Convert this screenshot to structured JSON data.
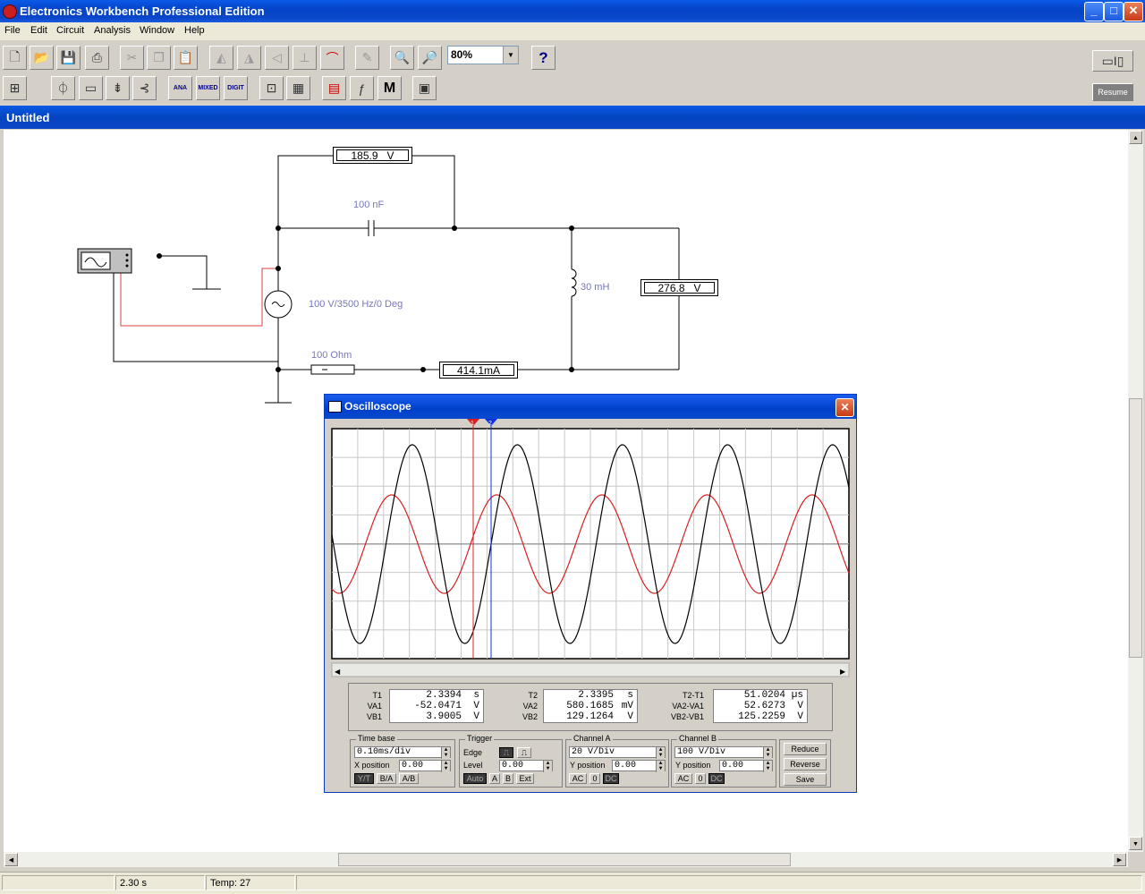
{
  "app": {
    "title": "Electronics Workbench Professional Edition",
    "window_buttons": {
      "minimize": "_",
      "maximize": "□",
      "close": "✕"
    }
  },
  "menu": [
    "File",
    "Edit",
    "Circuit",
    "Analysis",
    "Window",
    "Help"
  ],
  "toolbar": {
    "zoom": "80%",
    "help_label": "?",
    "parts_labels": {
      "analog_ics": "ANA",
      "mixed_ics": "MIXED",
      "digital_ics": "DIGIT",
      "misc_digital": "M"
    },
    "resume_label": "Resume"
  },
  "document": {
    "title": "Untitled"
  },
  "circuit": {
    "voltmeter_top": {
      "value": "185.9",
      "unit": "V"
    },
    "voltmeter_right": {
      "value": "276.8",
      "unit": "V"
    },
    "ammeter": {
      "value": "414.1m",
      "unit": "A"
    },
    "capacitor_label": "100 nF",
    "inductor_label": "30 mH",
    "source_label": "100 V/3500 Hz/0 Deg",
    "resistor_label": "100  Ohm"
  },
  "oscilloscope": {
    "title": "Oscilloscope",
    "cursor1_label": "1",
    "cursor2_label": "2",
    "readouts": {
      "t1": {
        "label": "T1",
        "value": "2.3394",
        "unit": "s"
      },
      "va1": {
        "label": "VA1",
        "value": "-52.0471",
        "unit": "V"
      },
      "vb1": {
        "label": "VB1",
        "value": "3.9005",
        "unit": "V"
      },
      "t2": {
        "label": "T2",
        "value": "2.3395",
        "unit": "s"
      },
      "va2": {
        "label": "VA2",
        "value": "580.1685",
        "unit": "mV"
      },
      "vb2": {
        "label": "VB2",
        "value": "129.1264",
        "unit": "V"
      },
      "t2t1": {
        "label": "T2-T1",
        "value": "51.0204",
        "unit": "µs"
      },
      "va2va1": {
        "label": "VA2-VA1",
        "value": "52.6273",
        "unit": "V"
      },
      "vb2vb1": {
        "label": "VB2-VB1",
        "value": "125.2259",
        "unit": "V"
      }
    },
    "timebase": {
      "header": "Time base",
      "value": "0.10ms/div",
      "xpos_label": "X position",
      "xpos": "0.00",
      "modes": [
        "Y/T",
        "B/A",
        "A/B"
      ]
    },
    "trigger": {
      "header": "Trigger",
      "edge_label": "Edge",
      "level_label": "Level",
      "level": "0.00",
      "modes": [
        "Auto",
        "A",
        "B",
        "Ext"
      ]
    },
    "channel_a": {
      "header": "Channel A",
      "value": "20 V/Div",
      "ypos_label": "Y position",
      "ypos": "0.00",
      "coupling": [
        "AC",
        "0",
        "DC"
      ]
    },
    "channel_b": {
      "header": "Channel B",
      "value": "100 V/Div",
      "ypos_label": "Y position",
      "ypos": "0.00",
      "coupling": [
        "AC",
        "0",
        "DC"
      ]
    },
    "buttons": {
      "reduce": "Reduce",
      "reverse": "Reverse",
      "save": "Save"
    }
  },
  "status": {
    "time": "2.30 s",
    "temp": "Temp:  27"
  }
}
